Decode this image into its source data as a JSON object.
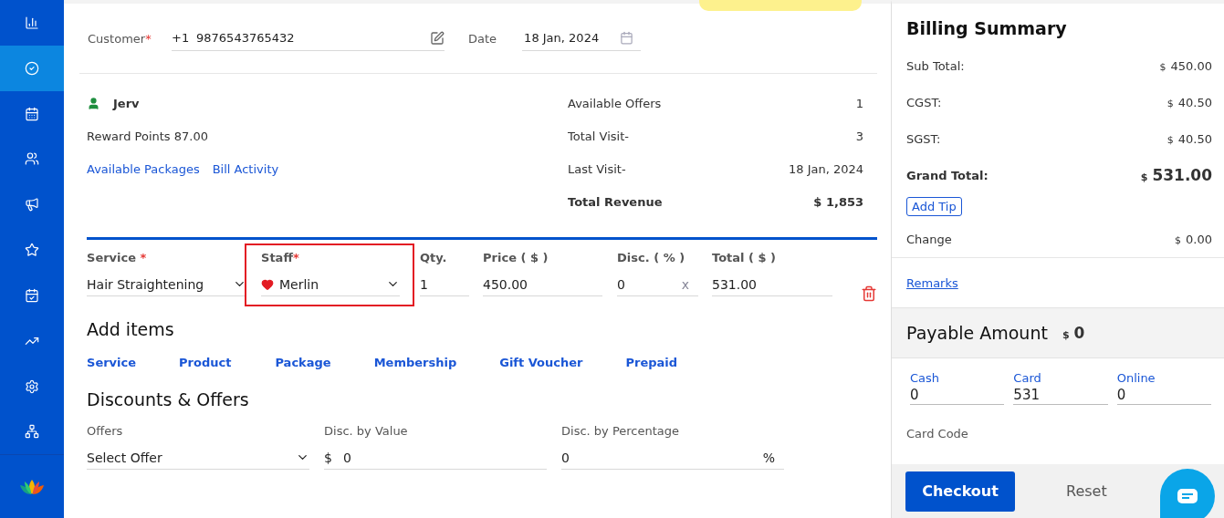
{
  "sidebar": {
    "items": [
      {
        "selected": false
      },
      {
        "selected": true
      },
      {
        "selected": false
      },
      {
        "selected": false
      },
      {
        "selected": false
      },
      {
        "selected": false
      },
      {
        "selected": false
      },
      {
        "selected": false
      },
      {
        "selected": false
      },
      {
        "selected": false
      }
    ]
  },
  "customer": {
    "label": "Customer",
    "mark": "*",
    "country_code": "+1",
    "phone": "9876543765432"
  },
  "date": {
    "label": "Date",
    "value": "18 Jan, 2024"
  },
  "client": {
    "name": "Jerv",
    "reward_points": "Reward Points 87.00",
    "links": [
      "Available Packages",
      "Bill Activity"
    ]
  },
  "stats": [
    {
      "label": "Available Offers",
      "value": "1",
      "bold": false
    },
    {
      "label": "Total Visit-",
      "value": "3",
      "bold": false
    },
    {
      "label": "Last Visit-",
      "value": "18 Jan, 2024",
      "bold": false
    },
    {
      "label": "Total Revenue",
      "value": "$ 1,853",
      "bold": true
    }
  ],
  "line_item": {
    "service": {
      "label": "Service",
      "mark": " *",
      "value": "Hair Straightening"
    },
    "staff": {
      "label": "Staff",
      "mark": "*",
      "value": "Merlin",
      "highlighted": true
    },
    "qty": {
      "label": "Qty.",
      "value": "1"
    },
    "price": {
      "label": "Price ( $ )",
      "value": "450.00"
    },
    "discount": {
      "label": "Disc. ( % )",
      "value": "0",
      "clear": "x"
    },
    "total": {
      "label": "Total ( $ )",
      "value": "531.00"
    }
  },
  "add_items": {
    "title": "Add items",
    "links": [
      "Service",
      "Product",
      "Package",
      "Membership",
      "Gift Voucher",
      "Prepaid"
    ]
  },
  "discounts": {
    "title": "Discounts & Offers",
    "offers": {
      "label": "Offers",
      "value": "Select Offer"
    },
    "by_value": {
      "label": "Disc. by Value",
      "prefix": "$",
      "value": "0"
    },
    "by_percentage": {
      "label": "Disc. by Percentage",
      "value": "0",
      "suffix": "%"
    }
  },
  "billing": {
    "title": "Billing Summary",
    "rows": [
      {
        "label": "Sub Total:",
        "currency": "$",
        "amount": "450.00",
        "kind": "normal"
      },
      {
        "label": "CGST:",
        "currency": "$",
        "amount": "40.50",
        "kind": "normal"
      },
      {
        "label": "SGST:",
        "currency": "$",
        "amount": "40.50",
        "kind": "normal"
      },
      {
        "label": "Grand Total:",
        "currency": "$",
        "amount": "531.00",
        "kind": "grand"
      }
    ],
    "add_tip": "Add Tip",
    "change": {
      "label": "Change",
      "currency": "$",
      "amount": "0.00"
    },
    "remarks": "Remarks",
    "payable": {
      "label": "Payable Amount",
      "currency": "$",
      "amount": "0"
    },
    "payments": [
      {
        "label": "Cash",
        "value": "0"
      },
      {
        "label": "Card",
        "value": "531"
      },
      {
        "label": "Online",
        "value": "0"
      }
    ],
    "card_code": "Card Code",
    "checkout": "Checkout",
    "reset": "Reset"
  }
}
